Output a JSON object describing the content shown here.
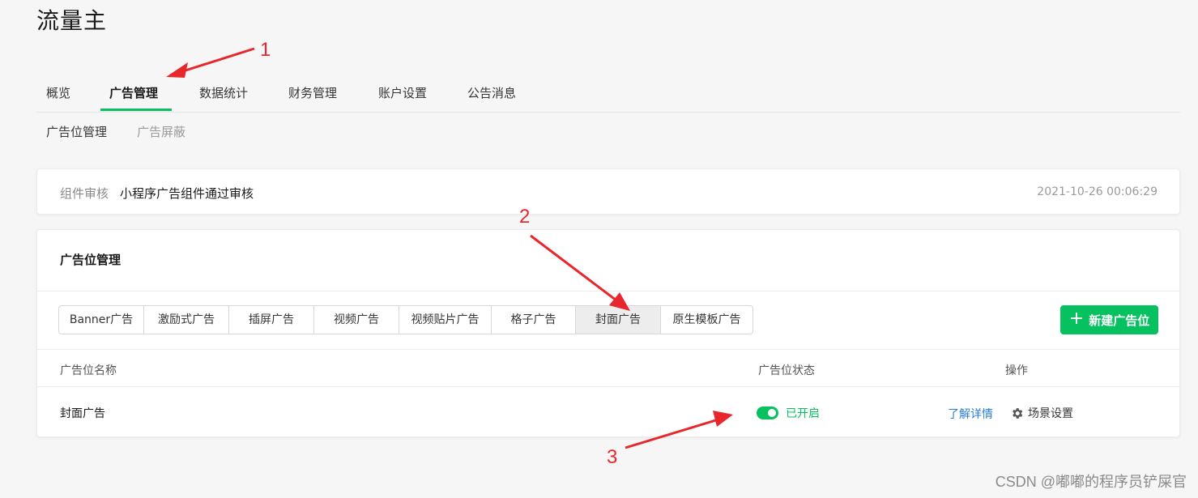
{
  "app": {
    "title": "流量主"
  },
  "main_nav": {
    "tabs": [
      {
        "label": "概览"
      },
      {
        "label": "广告管理",
        "active": true
      },
      {
        "label": "数据统计"
      },
      {
        "label": "财务管理"
      },
      {
        "label": "账户设置"
      },
      {
        "label": "公告消息"
      }
    ]
  },
  "sub_nav": {
    "tabs": [
      {
        "label": "广告位管理",
        "active": true
      },
      {
        "label": "广告屏蔽"
      }
    ]
  },
  "notice": {
    "label": "组件审核",
    "text": "小程序广告组件通过审核",
    "time": "2021-10-26 00:06:29"
  },
  "ad_section": {
    "title": "广告位管理",
    "ad_types": [
      "Banner广告",
      "激励式广告",
      "插屏广告",
      "视频广告",
      "视频贴片广告",
      "格子广告",
      "封面广告",
      "原生模板广告"
    ],
    "selected_type": "封面广告",
    "new_button": "新建广告位",
    "columns": [
      "广告位名称",
      "广告位状态",
      "操作"
    ],
    "rows": [
      {
        "name": "封面广告",
        "status": "已开启",
        "enabled": true,
        "actions": {
          "detail": "了解详情",
          "scene": "场景设置"
        }
      }
    ]
  },
  "annotations": [
    "1",
    "2",
    "3"
  ],
  "watermark": "CSDN @嘟嘟的程序员铲屎官",
  "colors": {
    "accent": "#07c160",
    "link": "#2a7dd4",
    "annotation": "#e8272c"
  }
}
